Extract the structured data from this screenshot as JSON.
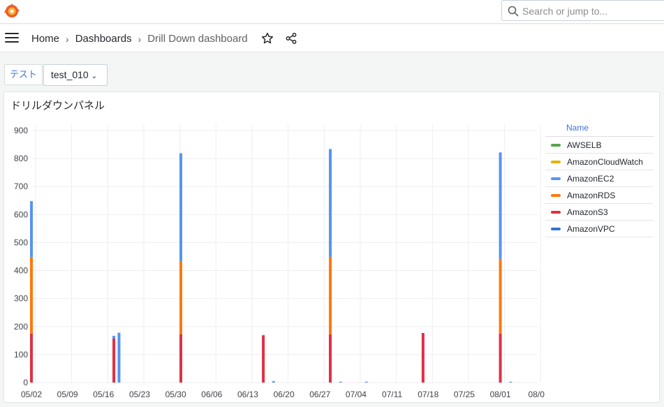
{
  "search": {
    "placeholder": "Search or jump to..."
  },
  "breadcrumbs": [
    {
      "label": "Home"
    },
    {
      "label": "Dashboards"
    },
    {
      "label": "Drill Down dashboard"
    }
  ],
  "variable": {
    "label": "テスト",
    "value": "test_010"
  },
  "panel": {
    "title": "ドリルダウンパネル"
  },
  "icons": {
    "logo": "grafana-logo-icon",
    "search": "search-icon",
    "menu": "menu-icon",
    "star": "star-icon",
    "share": "share-icon",
    "chevron": "chevron-down-icon"
  },
  "colors": {
    "AWSELB": "#56a64b",
    "AmazonCloudWatch": "#e0b400",
    "AmazonEC2": "#5794f2",
    "AmazonRDS": "#ff780a",
    "AmazonS3": "#e02f44",
    "AmazonVPC": "#3274d9"
  },
  "legend": {
    "header": "Name",
    "items": [
      "AWSELB",
      "AmazonCloudWatch",
      "AmazonEC2",
      "AmazonRDS",
      "AmazonS3",
      "AmazonVPC"
    ]
  },
  "chart_data": {
    "type": "bar",
    "stacked": true,
    "x_axis": {
      "type": "date",
      "start": "05/02",
      "end": "08/04",
      "ticks": [
        "05/02",
        "05/09",
        "05/16",
        "05/23",
        "05/30",
        "06/06",
        "06/13",
        "06/20",
        "06/27",
        "07/04",
        "07/11",
        "07/18",
        "07/25",
        "08/01",
        "08/0"
      ]
    },
    "ylim": [
      0,
      900
    ],
    "yticks": [
      0,
      100,
      200,
      300,
      400,
      500,
      600,
      700,
      800,
      900
    ],
    "grid": true,
    "legend_position": "right",
    "series": [
      {
        "name": "AmazonS3",
        "points": [
          {
            "x": "05/02",
            "y": 175
          },
          {
            "x": "05/18",
            "y": 157
          },
          {
            "x": "05/31",
            "y": 172
          },
          {
            "x": "06/16",
            "y": 167
          },
          {
            "x": "06/29",
            "y": 172
          },
          {
            "x": "07/17",
            "y": 177
          },
          {
            "x": "08/01",
            "y": 175
          }
        ]
      },
      {
        "name": "AmazonRDS",
        "points": [
          {
            "x": "05/02",
            "y": 273
          },
          {
            "x": "05/31",
            "y": 262
          },
          {
            "x": "06/29",
            "y": 277
          },
          {
            "x": "08/01",
            "y": 267
          }
        ]
      },
      {
        "name": "AmazonEC2",
        "points": [
          {
            "x": "05/02",
            "y": 200
          },
          {
            "x": "05/18",
            "y": 10
          },
          {
            "x": "05/19",
            "y": 178
          },
          {
            "x": "05/31",
            "y": 385
          },
          {
            "x": "06/16",
            "y": 3
          },
          {
            "x": "06/18",
            "y": 5
          },
          {
            "x": "06/29",
            "y": 385
          },
          {
            "x": "07/01",
            "y": 3
          },
          {
            "x": "07/06",
            "y": 3
          },
          {
            "x": "08/01",
            "y": 380
          },
          {
            "x": "08/03",
            "y": 3
          }
        ]
      }
    ]
  }
}
